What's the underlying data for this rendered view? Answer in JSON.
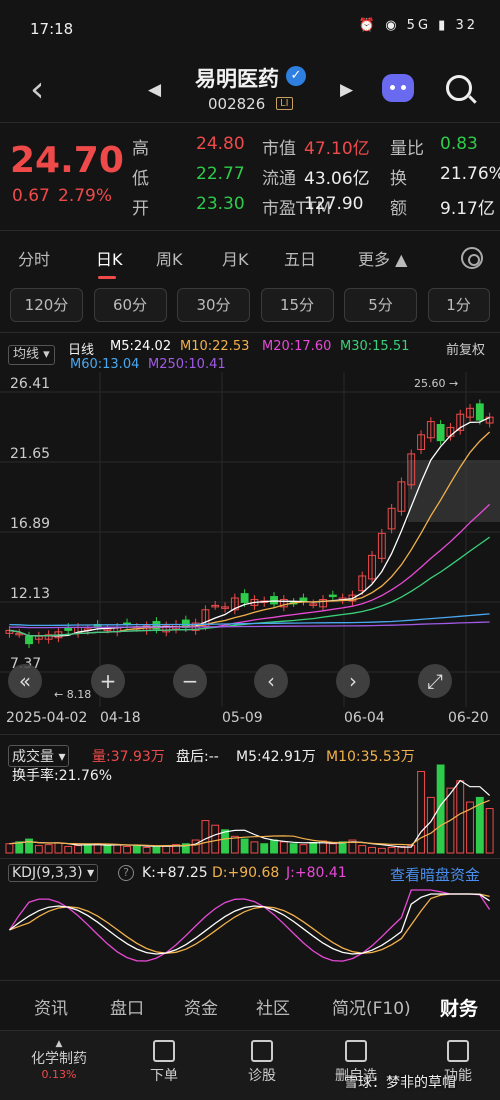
{
  "status": {
    "time": "17:18",
    "network": "5G",
    "battery": "32"
  },
  "header": {
    "name": "易明医药",
    "code": "002826",
    "badge": "LI"
  },
  "quote": {
    "price": "24.70",
    "change": "0.67",
    "change_pct": "2.79%",
    "rows": [
      {
        "l1": "高",
        "v1": "24.80",
        "l2": "市值",
        "v2": "47.10亿",
        "l3": "量比",
        "v3": "0.83"
      },
      {
        "l1": "低",
        "v1": "22.77",
        "l2": "流通",
        "v2": "43.06亿",
        "l3": "换",
        "v3": "21.76%"
      },
      {
        "l1": "开",
        "v1": "23.30",
        "l2": "市盈TTM",
        "v2": "127.90",
        "l3": "额",
        "v3": "9.17亿"
      }
    ]
  },
  "period_tabs": [
    "分时",
    "日K",
    "周K",
    "月K",
    "五日",
    "更多 ▲"
  ],
  "minute_buttons": [
    "120分",
    "60分",
    "30分",
    "15分",
    "5分",
    "1分"
  ],
  "ma": {
    "toggle": "均线",
    "line_label": "日线",
    "restore": "前复权",
    "items": [
      {
        "label": "M5:24.02",
        "color": "#ffffff"
      },
      {
        "label": "M10:22.53",
        "color": "#f2b14c"
      },
      {
        "label": "M20:17.60",
        "color": "#e64ad6"
      },
      {
        "label": "M30:15.51",
        "color": "#3ad07a"
      },
      {
        "label": "M60:13.04",
        "color": "#4aa8f0"
      },
      {
        "label": "M250:10.41",
        "color": "#a05ae6"
      }
    ]
  },
  "chart": {
    "y_labels": [
      "26.41",
      "21.65",
      "16.89",
      "12.13",
      "7.37"
    ],
    "high_mark": "25.60",
    "low_mark": "8.18",
    "dates": [
      "2025-04-02",
      "04-18",
      "05-09",
      "06-04",
      "06-20"
    ]
  },
  "volume": {
    "title": "成交量",
    "vol": "量:37.93万",
    "after": "盘后:--",
    "m5": "M5:42.91万",
    "m10": "M10:35.53万",
    "turnover": "换手率:21.76%"
  },
  "kdj": {
    "title": "KDJ(9,3,3)",
    "k": "K:+87.25",
    "d": "D:+90.68",
    "j": "J:+80.41",
    "link": "查看暗盘资金"
  },
  "sub_tabs": [
    "资讯",
    "盘口",
    "资金",
    "社区",
    "简况(F10)",
    "财务"
  ],
  "nav": [
    {
      "label": "化学制药",
      "sub": "0.13%"
    },
    {
      "label": "下单"
    },
    {
      "label": "诊股"
    },
    {
      "label": "删自选"
    },
    {
      "label": "功能"
    }
  ],
  "watermark": "雪球：梦非的草帽",
  "chart_data": {
    "type": "candlestick",
    "dates": [
      "2025-04-02",
      "04-18",
      "05-09",
      "06-04",
      "06-20"
    ],
    "ylim": [
      7.37,
      26.41
    ],
    "close_series": [
      10.2,
      10.0,
      9.3,
      9.8,
      9.9,
      10.1,
      10.2,
      10.4,
      10.3,
      10.5,
      10.3,
      10.4,
      10.6,
      10.4,
      10.5,
      10.3,
      10.5,
      10.6,
      10.4,
      10.7,
      11.6,
      11.9,
      11.8,
      12.4,
      12.1,
      12.3,
      12.2,
      12.0,
      12.3,
      12.1,
      12.2,
      12.0,
      12.3,
      12.5,
      12.4,
      12.6,
      13.9,
      15.3,
      16.8,
      18.5,
      20.3,
      22.2,
      23.5,
      24.4,
      23.1,
      24.0,
      24.9,
      25.3,
      24.5,
      24.7
    ],
    "volume_series": [
      10,
      12,
      15,
      8,
      9,
      11,
      7,
      8,
      9,
      10,
      8,
      9,
      7,
      8,
      6,
      7,
      8,
      9,
      10,
      14,
      35,
      30,
      25,
      18,
      15,
      12,
      10,
      14,
      12,
      10,
      9,
      11,
      13,
      10,
      12,
      14,
      8,
      6,
      5,
      6,
      7,
      8,
      88,
      60,
      95,
      70,
      78,
      55,
      60,
      48
    ]
  }
}
